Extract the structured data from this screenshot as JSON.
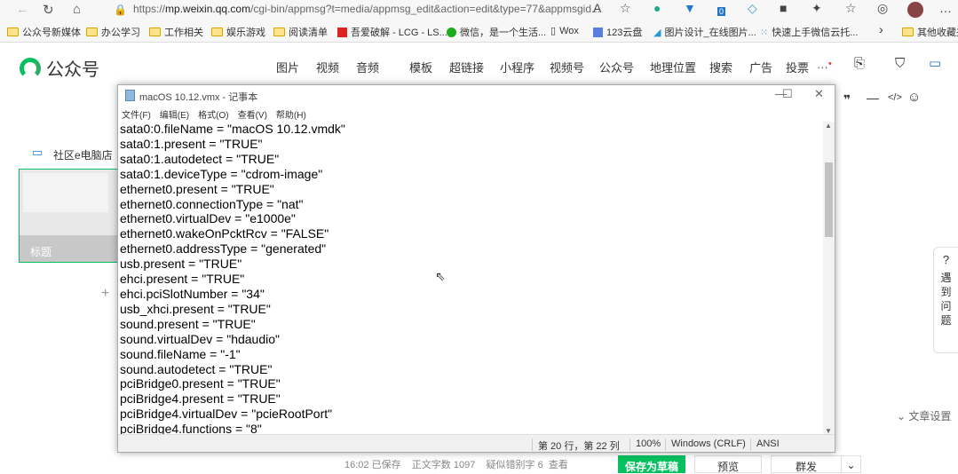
{
  "browser": {
    "url_prefix": "https://",
    "url_host": "mp.weixin.qq.com",
    "url_rest": "/cgi-bin/appmsg?t=media/appmsg_edit&action=edit&type=77&appmsgid...",
    "download_badge": "0"
  },
  "bookmarks": [
    "公众号新媒体",
    "办公学习",
    "工作相关",
    "娱乐游戏",
    "阅读清单",
    "吾爱破解 - LCG - LS...",
    "微信，是一个生活...",
    "Wox",
    "123云盘",
    "图片设计_在线图片...",
    "快速上手微信云托...",
    "其他收藏夹"
  ],
  "app": {
    "logo": "公众号",
    "nav": [
      "图片",
      "视频",
      "音频",
      "模板",
      "超链接",
      "小程序",
      "视频号",
      "公众号",
      "地理位置",
      "搜索",
      "广告",
      "投票"
    ]
  },
  "side": {
    "shop": "社区e电脑店",
    "card_title": "标题",
    "help": "遇到问题",
    "settings": "文章设置"
  },
  "notepad": {
    "title": "macOS 10.12.vmx - 记事本",
    "menu": [
      "文件(F)",
      "编辑(E)",
      "格式(O)",
      "查看(V)",
      "帮助(H)"
    ],
    "lines": [
      "sata0:0.fileName = \"macOS 10.12.vmdk\"",
      "sata0:1.present = \"TRUE\"",
      "sata0:1.autodetect = \"TRUE\"",
      "sata0:1.deviceType = \"cdrom-image\"",
      "ethernet0.present = \"TRUE\"",
      "ethernet0.connectionType = \"nat\"",
      "ethernet0.virtualDev = \"e1000e\"",
      "ethernet0.wakeOnPcktRcv = \"FALSE\"",
      "ethernet0.addressType = \"generated\"",
      "usb.present = \"TRUE\"",
      "ehci.present = \"TRUE\"",
      "ehci.pciSlotNumber = \"34\"",
      "usb_xhci.present = \"TRUE\"",
      "sound.present = \"TRUE\"",
      "sound.virtualDev = \"hdaudio\"",
      "sound.fileName = \"-1\"",
      "sound.autodetect = \"TRUE\"",
      "pciBridge0.present = \"TRUE\"",
      "pciBridge4.present = \"TRUE\"",
      "pciBridge4.virtualDev = \"pcieRootPort\"",
      "pciBridge4.functions = \"8\""
    ],
    "status": {
      "position": "第 20 行，第 22 列",
      "zoom": "100%",
      "eol": "Windows (CRLF)",
      "encoding": "ANSI"
    }
  },
  "footer": {
    "info": "16:02 已保存    正文字数 1097    疑似错别字 6  查看",
    "save_draft": "保存为草稿",
    "preview": "预览",
    "publish": "群发"
  }
}
